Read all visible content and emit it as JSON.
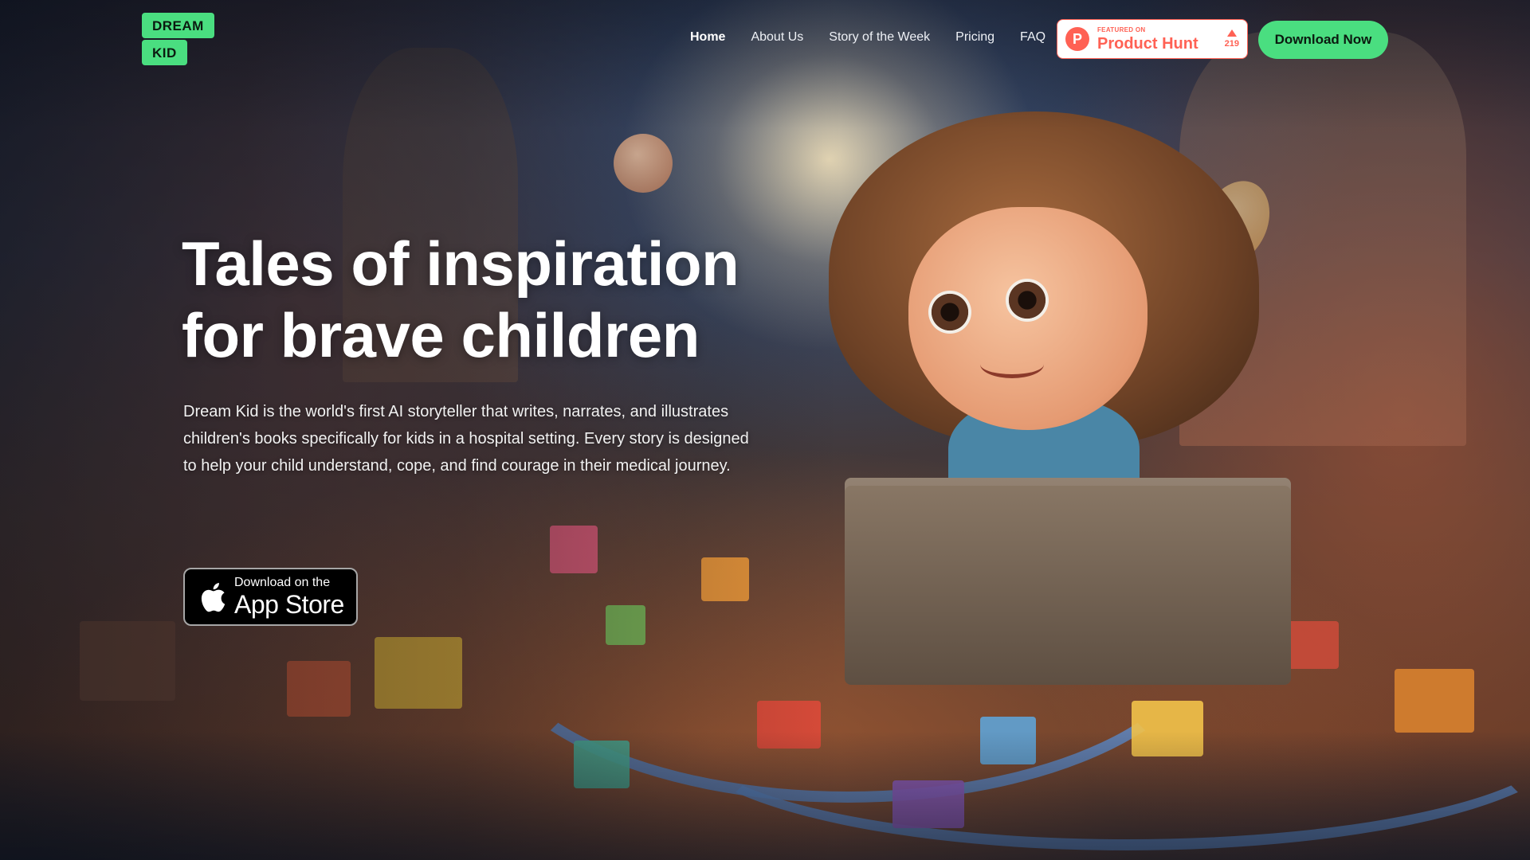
{
  "brand": {
    "logo_line1": "DREAM",
    "logo_line2": "KID",
    "accent_color": "#4ade80"
  },
  "nav": {
    "items": [
      {
        "label": "Home",
        "active": true
      },
      {
        "label": "About Us",
        "active": false
      },
      {
        "label": "Story of the Week",
        "active": false
      },
      {
        "label": "Pricing",
        "active": false
      },
      {
        "label": "FAQ",
        "active": false
      }
    ]
  },
  "product_hunt": {
    "featured_label": "FEATURED ON",
    "name": "Product Hunt",
    "votes": "219",
    "logo_letter": "P",
    "color": "#ff6154"
  },
  "header_cta": {
    "label": "Download Now"
  },
  "hero": {
    "title_line1": "Tales of inspiration",
    "title_line2": "for brave children",
    "description": "Dream Kid is the world's first AI storyteller that writes, narrates, and illustrates children's books specifically for kids in a hospital setting. Every story is designed to help your child understand, cope, and find courage in their medical journey."
  },
  "app_store": {
    "small_label": "Download on the",
    "big_label": "App Store",
    "icon": "apple-icon"
  },
  "background": {
    "description_icon": "illustration-girl-toys"
  }
}
